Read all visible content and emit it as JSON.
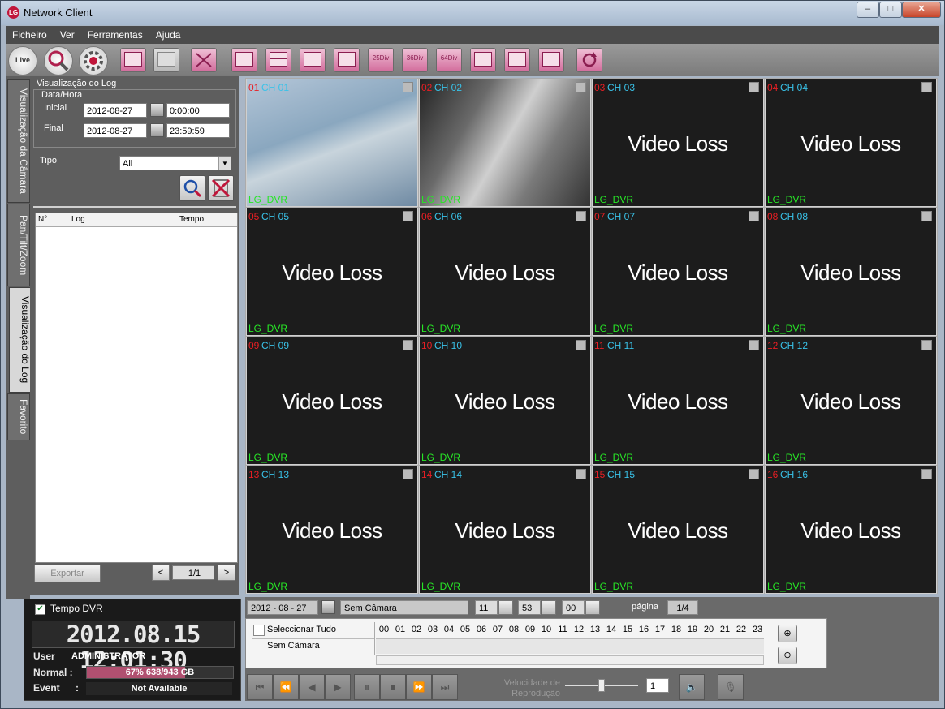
{
  "window": {
    "title": "Network Client",
    "btn_min": "–",
    "btn_max": "□",
    "btn_close": "✕"
  },
  "menu": [
    "Ficheiro",
    "Ver",
    "Ferramentas",
    "Ajuda"
  ],
  "toolbar": {
    "live": "Live",
    "layouts": [
      "",
      "",
      "",
      "",
      "25Div",
      "36Div",
      "64Div",
      "",
      "",
      ""
    ]
  },
  "side_tabs": [
    "Visualização da Câmara",
    "Pan/Tilt/Zoom",
    "Visualização do Log",
    "Favorito"
  ],
  "log_panel": {
    "section_title": "Visualização do Log",
    "datetime_title": "Data/Hora",
    "start_label": "Inicial",
    "start_date": "2012-08-27",
    "start_time": "0:00:00",
    "end_label": "Final",
    "end_date": "2012-08-27",
    "end_time": "23:59:59",
    "type_label": "Tipo",
    "type_value": "All",
    "columns": [
      "N°",
      "Log",
      "Tempo"
    ],
    "export_label": "Exportar",
    "page": "1/1"
  },
  "dvr": {
    "checkbox_label": "Tempo DVR",
    "clock": "2012.08.15 12:01:30",
    "user_label": "User",
    "user_value": "ADMINISTRATOR",
    "normal_label": "Normal :",
    "normal_value": "67% 638/943 GB",
    "normal_fraction": 0.67,
    "event_label": "Event",
    "event_colon": ":",
    "event_value": "Not Available"
  },
  "channels": [
    {
      "num": "01",
      "name": "CH 01",
      "status": "",
      "osd": "LG_DVR"
    },
    {
      "num": "02",
      "name": "CH 02",
      "status": "",
      "osd": "LG_DVR"
    },
    {
      "num": "03",
      "name": "CH 03",
      "status": "Video Loss",
      "osd": "LG_DVR"
    },
    {
      "num": "04",
      "name": "CH 04",
      "status": "Video Loss",
      "osd": "LG_DVR"
    },
    {
      "num": "05",
      "name": "CH 05",
      "status": "Video Loss",
      "osd": "LG_DVR"
    },
    {
      "num": "06",
      "name": "CH 06",
      "status": "Video Loss",
      "osd": "LG_DVR"
    },
    {
      "num": "07",
      "name": "CH 07",
      "status": "Video Loss",
      "osd": "LG_DVR"
    },
    {
      "num": "08",
      "name": "CH 08",
      "status": "Video Loss",
      "osd": "LG_DVR"
    },
    {
      "num": "09",
      "name": "CH 09",
      "status": "Video Loss",
      "osd": "LG_DVR"
    },
    {
      "num": "10",
      "name": "CH 10",
      "status": "Video Loss",
      "osd": "LG_DVR"
    },
    {
      "num": "11",
      "name": "CH 11",
      "status": "Video Loss",
      "osd": "LG_DVR"
    },
    {
      "num": "12",
      "name": "CH 12",
      "status": "Video Loss",
      "osd": "LG_DVR"
    },
    {
      "num": "13",
      "name": "CH 13",
      "status": "Video Loss",
      "osd": "LG_DVR"
    },
    {
      "num": "14",
      "name": "CH 14",
      "status": "Video Loss",
      "osd": "LG_DVR"
    },
    {
      "num": "15",
      "name": "CH 15",
      "status": "Video Loss",
      "osd": "LG_DVR"
    },
    {
      "num": "16",
      "name": "CH 16",
      "status": "Video Loss",
      "osd": "LG_DVR"
    }
  ],
  "playback": {
    "date": "2012 - 08 - 27",
    "camera": "Sem Câmara",
    "hour": "11",
    "minute": "53",
    "second": "00",
    "page_label": "página",
    "page_value": "1/4",
    "select_all": "Seleccionar Tudo",
    "row_camera": "Sem Câmara",
    "hours": [
      "00",
      "01",
      "02",
      "03",
      "04",
      "05",
      "06",
      "07",
      "08",
      "09",
      "10",
      "11",
      "12",
      "13",
      "14",
      "15",
      "16",
      "17",
      "18",
      "19",
      "20",
      "21",
      "22",
      "23"
    ],
    "speed_label": "Velocidade de Reprodução",
    "speed_value": "1",
    "buttons": [
      "⏮",
      "⏪",
      "◀",
      "▶",
      "⏸",
      "■",
      "⏩",
      "⏭"
    ]
  },
  "colors": {
    "channel_number": "#e81f24",
    "channel_name": "#39c2e8",
    "osd": "#27e626",
    "accent": "#d26c9c"
  },
  "icons": [
    "live-icon",
    "search-icon",
    "settings-icon",
    "export-icon",
    "print-icon",
    "fullscreen-icon",
    "refresh-icon",
    "speaker-icon",
    "zoom-in-icon",
    "zoom-out-icon",
    "microphone-icon",
    "calendar-icon",
    "delete-icon"
  ]
}
